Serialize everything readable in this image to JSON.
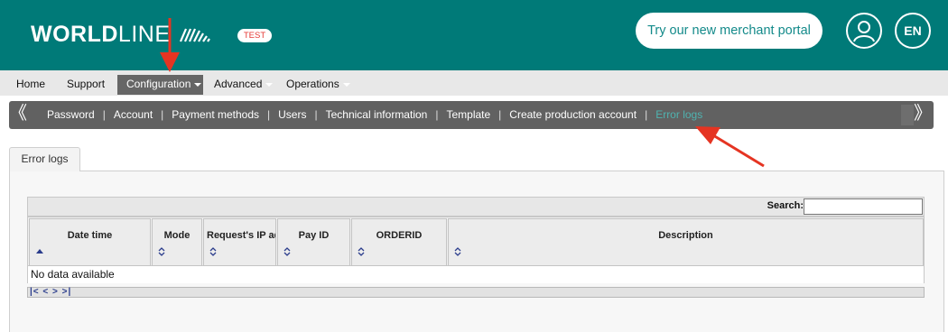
{
  "header": {
    "logo_bold": "WORLD",
    "logo_light": "LINE",
    "env_badge": "TEST",
    "portal_button": "Try our new merchant portal",
    "language": "EN",
    "user_icon": "user-circle-icon",
    "brand_color": "#007a78"
  },
  "menu": {
    "items": [
      {
        "label": "Home"
      },
      {
        "label": "Support"
      },
      {
        "label": "Configuration",
        "active": true
      },
      {
        "label": "Advanced"
      },
      {
        "label": "Operations"
      }
    ]
  },
  "submenu": {
    "prev": "《",
    "next": "》",
    "items": [
      {
        "label": "Password"
      },
      {
        "label": "Account"
      },
      {
        "label": "Payment methods"
      },
      {
        "label": "Users"
      },
      {
        "label": "Technical information"
      },
      {
        "label": "Template"
      },
      {
        "label": "Create production account"
      },
      {
        "label": "Error logs",
        "current": true
      }
    ],
    "separator": "|"
  },
  "tab": {
    "label": "Error logs"
  },
  "grid": {
    "search_label": "Search:",
    "search_value": "",
    "columns": [
      {
        "label": "Date time",
        "sort": "asc"
      },
      {
        "label": "Mode",
        "sort": "both"
      },
      {
        "label": "Request's IP ad",
        "sort": "both"
      },
      {
        "label": "Pay ID",
        "sort": "both"
      },
      {
        "label": "ORDERID",
        "sort": "both"
      },
      {
        "label": "Description",
        "sort": "both"
      }
    ],
    "empty_text": "No data available",
    "pager": "|< < > >|"
  },
  "annotation_color": "#e53422"
}
